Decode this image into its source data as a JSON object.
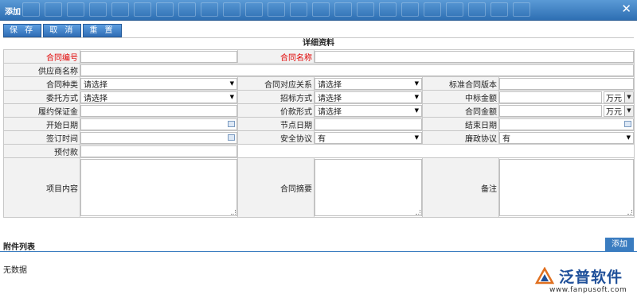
{
  "window": {
    "title": "添加"
  },
  "toolbar": {
    "save": "保 存",
    "cancel": "取 消",
    "reset": "重 置"
  },
  "form": {
    "section_title": "详细资料",
    "contract_no": {
      "label": "合同编号",
      "value": ""
    },
    "contract_name": {
      "label": "合同名称",
      "value": ""
    },
    "supplier_name": {
      "label": "供应商名称",
      "value": ""
    },
    "contract_type": {
      "label": "合同种类",
      "value": "请选择"
    },
    "contract_relation": {
      "label": "合同对应关系",
      "value": "请选择"
    },
    "standard_version": {
      "label": "标准合同版本",
      "value": ""
    },
    "entrust_method": {
      "label": "委托方式",
      "value": "请选择"
    },
    "bidding_method": {
      "label": "招标方式",
      "value": "请选择"
    },
    "bid_amount": {
      "label": "中标金额",
      "value": "",
      "unit": "万元"
    },
    "performance_bond": {
      "label": "履约保证金",
      "value": ""
    },
    "price_form": {
      "label": "价款形式",
      "value": "请选择"
    },
    "contract_amount": {
      "label": "合同金额",
      "value": "",
      "unit": "万元"
    },
    "start_date": {
      "label": "开始日期",
      "value": ""
    },
    "node_date": {
      "label": "节点日期",
      "value": ""
    },
    "end_date": {
      "label": "结束日期",
      "value": ""
    },
    "sign_time": {
      "label": "签订时间",
      "value": ""
    },
    "safety_agreement": {
      "label": "安全协议",
      "value": "有"
    },
    "integrity_agreement": {
      "label": "廉政协议",
      "value": "有"
    },
    "advance_payment": {
      "label": "预付款",
      "value": ""
    },
    "project_content": {
      "label": "项目内容",
      "value": ""
    },
    "contract_summary": {
      "label": "合同摘要",
      "value": ""
    },
    "remarks": {
      "label": "备注",
      "value": ""
    }
  },
  "attachments": {
    "title": "附件列表",
    "add_label": "添加",
    "empty_text": "无数据"
  },
  "logo": {
    "name": "泛普软件",
    "url": "www.fanpusoft.com"
  },
  "colors": {
    "accent": "#3a7cc0",
    "required_label": "#e00000",
    "titlebar": "#2e6fb3"
  }
}
